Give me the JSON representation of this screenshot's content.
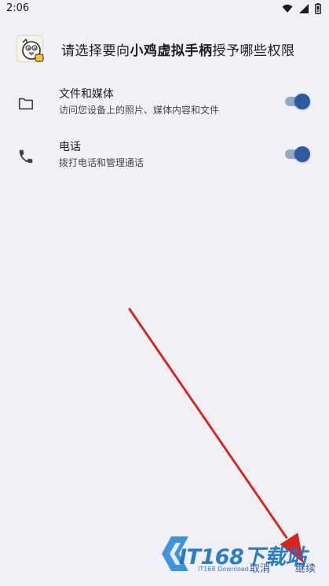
{
  "status_bar": {
    "time": "2:06",
    "icons": [
      "wifi-icon",
      "signal-icon",
      "battery-icon"
    ]
  },
  "header": {
    "prefix": "请选择要向",
    "app_name": "小鸡虚拟手柄",
    "suffix": "授予哪些权限"
  },
  "permissions": [
    {
      "icon": "folder-icon",
      "title": "文件和媒体",
      "subtitle": "访问您设备上的照片、媒体内容和文件",
      "enabled": true
    },
    {
      "icon": "phone-icon",
      "title": "电话",
      "subtitle": "拨打电话和管理通话",
      "enabled": true
    }
  ],
  "buttons": {
    "cancel": "取消",
    "continue": "继续"
  },
  "watermark": {
    "text": "IT168下载站",
    "sub": "IT168 Download"
  },
  "colors": {
    "background": "#f1f0f6",
    "accent": "#2d5aa0",
    "toggle_track": "#94a7c6",
    "annotation_arrow": "#e0221c",
    "watermark": "#1a73c2"
  }
}
